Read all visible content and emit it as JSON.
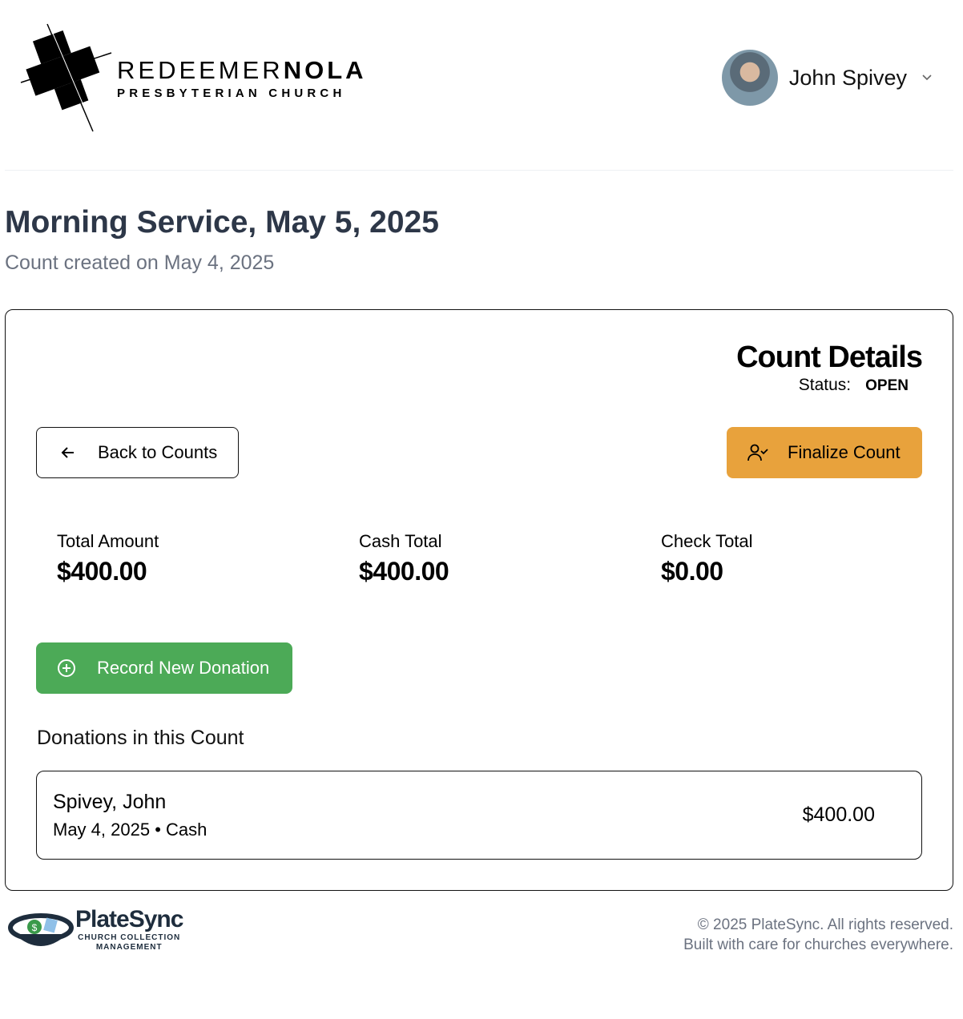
{
  "header": {
    "logo_line1_a": "REDEEMER",
    "logo_line1_b": "NOLA",
    "logo_line2": "PRESBYTERIAN CHURCH",
    "user_name": "John Spivey"
  },
  "page": {
    "title": "Morning Service, May 5, 2025",
    "subtitle": "Count created on May 4, 2025"
  },
  "card": {
    "title": "Count Details",
    "status_label": "Status:",
    "status_value": "OPEN",
    "back_label": "Back to Counts",
    "finalize_label": "Finalize Count",
    "finalize_color": "#e8a23c",
    "stats": [
      {
        "label": "Total Amount",
        "value": "$400.00"
      },
      {
        "label": "Cash Total",
        "value": "$400.00"
      },
      {
        "label": "Check Total",
        "value": "$0.00"
      }
    ],
    "record_label": "Record New Donation",
    "record_color": "#4caa57",
    "donations_heading": "Donations in this Count",
    "donations": [
      {
        "name": "Spivey, John",
        "meta": "May 4, 2025 • Cash",
        "amount": "$400.00"
      }
    ]
  },
  "footer": {
    "brand": "PlateSync",
    "brand_tagline_1": "CHURCH COLLECTION",
    "brand_tagline_2": "MANAGEMENT",
    "copyright": "© 2025 PlateSync. All rights reserved.",
    "tagline": "Built with care for churches everywhere."
  }
}
